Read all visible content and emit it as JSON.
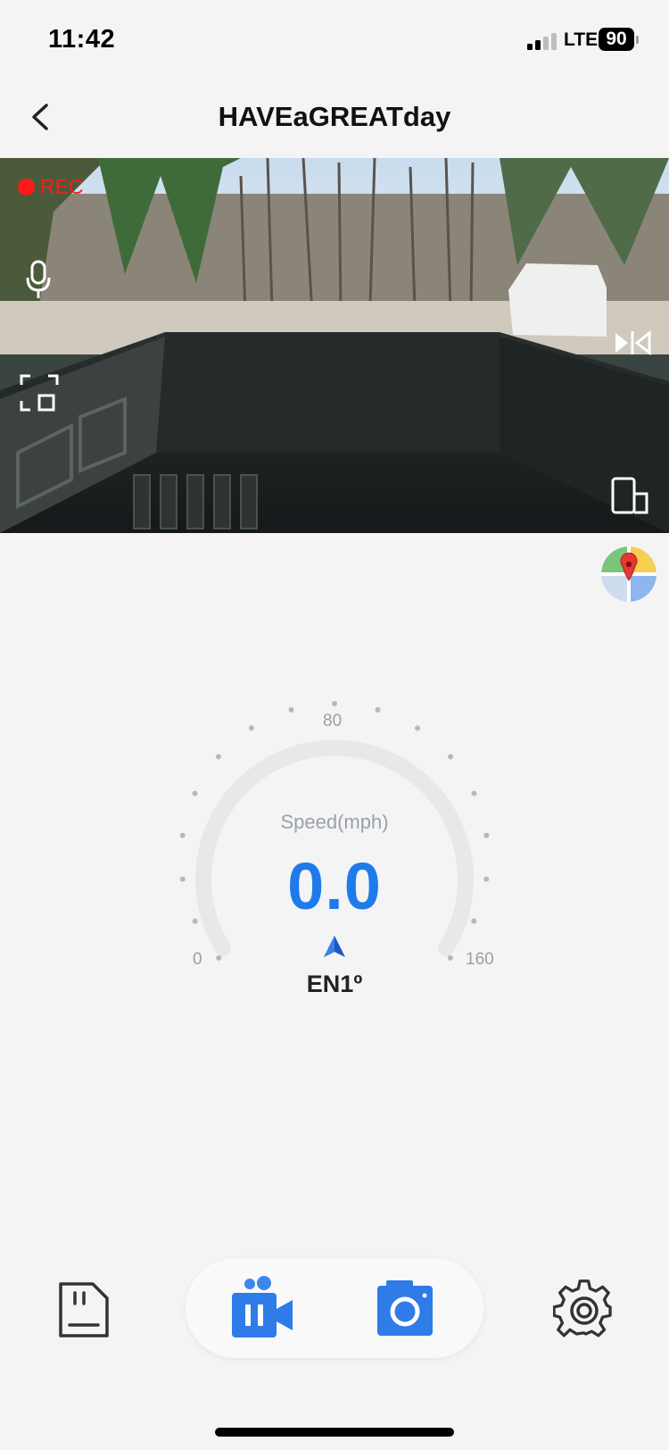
{
  "status_bar": {
    "time": "11:42",
    "network": "LTE",
    "battery": "90"
  },
  "header": {
    "title": "HAVEaGREATday"
  },
  "camera": {
    "rec_label": "REC"
  },
  "speedometer": {
    "label": "Speed(mph)",
    "value": "0.0",
    "min_label": "0",
    "mid_label": "80",
    "max_label": "160",
    "heading": "EN1º",
    "accent_color": "#1f7bea"
  },
  "toolbar": {
    "icons": [
      "sd-card-icon",
      "pause-video-icon",
      "camera-icon",
      "gear-icon"
    ]
  }
}
